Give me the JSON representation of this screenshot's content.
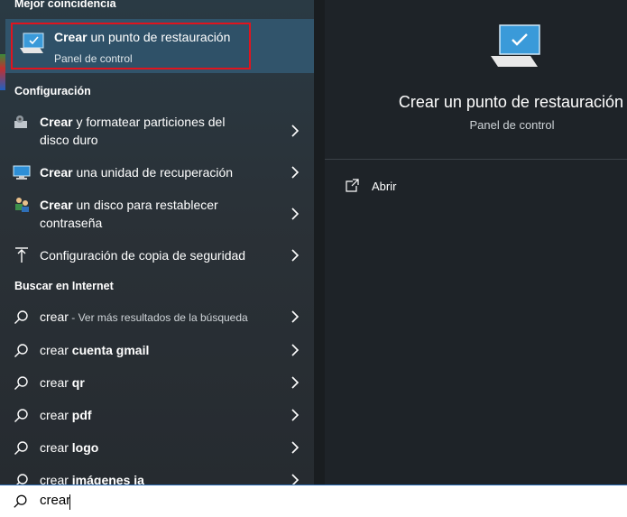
{
  "left": {
    "best_match_heading": "Mejor coincidencia",
    "best_match": {
      "title_bold": "Crear",
      "title_rest": " un punto de restauración",
      "subtitle": "Panel de control"
    },
    "settings_heading": "Configuración",
    "settings_items": [
      {
        "bold": "Crear",
        "rest": " y formatear particiones del disco duro",
        "icon": "disk-management-icon"
      },
      {
        "bold": "Crear",
        "rest": " una unidad de recuperación",
        "icon": "monitor-icon"
      },
      {
        "bold": "Crear",
        "rest": " un disco para restablecer contraseña",
        "icon": "users-icon"
      },
      {
        "bold": "",
        "rest": "Configuración de copia de seguridad",
        "icon": "upload-arrow-icon"
      }
    ],
    "web_heading": "Buscar en Internet",
    "web_items": [
      {
        "plain": "crear",
        "bold": "",
        "muted": " - Ver más resultados de la búsqueda"
      },
      {
        "plain": "crear ",
        "bold": "cuenta gmail",
        "muted": ""
      },
      {
        "plain": "crear ",
        "bold": "qr",
        "muted": ""
      },
      {
        "plain": "crear ",
        "bold": "pdf",
        "muted": ""
      },
      {
        "plain": "crear ",
        "bold": "logo",
        "muted": ""
      },
      {
        "plain": "crear ",
        "bold": "imágenes ia",
        "muted": ""
      }
    ]
  },
  "preview": {
    "title": "Crear un punto de restauración",
    "subtitle": "Panel de control",
    "open_label": "Abrir"
  },
  "search": {
    "value": "crear"
  },
  "colors": {
    "highlight_border": "#e0141e",
    "selected_bg": "#31546b",
    "accent": "#2b6cb3"
  }
}
